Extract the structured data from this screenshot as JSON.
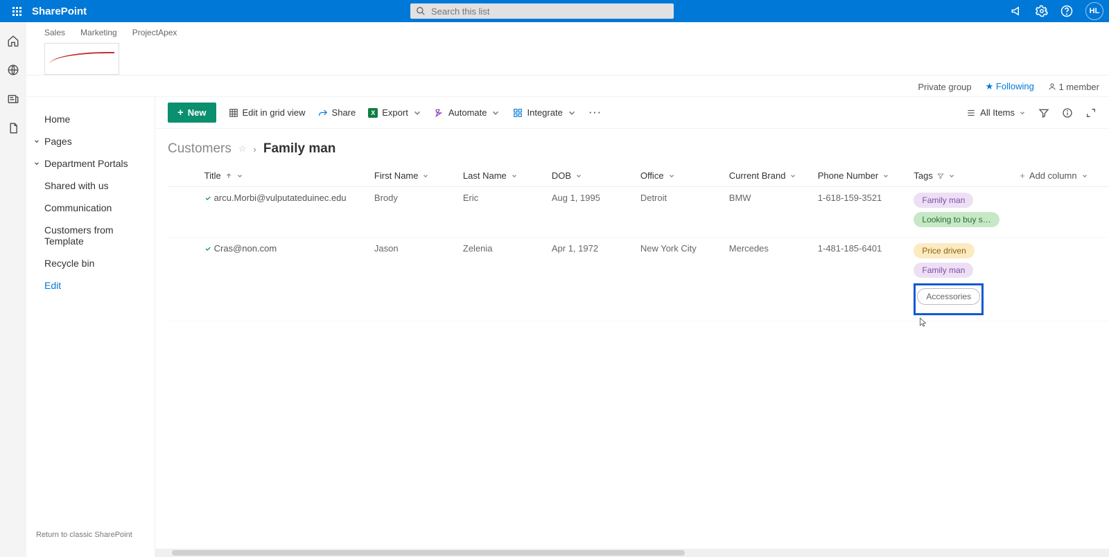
{
  "suite": {
    "brand": "SharePoint",
    "search_placeholder": "Search this list",
    "avatar": "HL"
  },
  "hub": {
    "links": [
      "Sales",
      "Marketing",
      "ProjectApex"
    ]
  },
  "siteinfo": {
    "group": "Private group",
    "following": "Following",
    "members": "1 member"
  },
  "nav": {
    "home": "Home",
    "pages": "Pages",
    "dept": "Department Portals",
    "shared": "Shared with us",
    "comm": "Communication",
    "cust": "Customers from Template",
    "recycle": "Recycle bin",
    "edit": "Edit",
    "classic": "Return to classic SharePoint"
  },
  "cmd": {
    "new": "New",
    "grid": "Edit in grid view",
    "share": "Share",
    "export": "Export",
    "automate": "Automate",
    "integrate": "Integrate",
    "view": "All Items"
  },
  "crumb": {
    "root": "Customers",
    "leaf": "Family man"
  },
  "columns": {
    "title": "Title",
    "first": "First Name",
    "last": "Last Name",
    "dob": "DOB",
    "office": "Office",
    "brand": "Current Brand",
    "phone": "Phone Number",
    "tags": "Tags",
    "add": "Add column"
  },
  "rows": [
    {
      "title": "arcu.Morbi@vulputateduinec.edu",
      "first": "Brody",
      "last": "Eric",
      "dob": "Aug 1, 1995",
      "office": "Detroit",
      "brand": "BMW",
      "phone": "1-618-159-3521",
      "tags": [
        {
          "text": "Family man",
          "cls": "family"
        },
        {
          "text": "Looking to buy s…",
          "cls": "looking"
        }
      ]
    },
    {
      "title": "Cras@non.com",
      "first": "Jason",
      "last": "Zelenia",
      "dob": "Apr 1, 1972",
      "office": "New York City",
      "brand": "Mercedes",
      "phone": "1-481-185-6401",
      "tags": [
        {
          "text": "Price driven",
          "cls": "price"
        },
        {
          "text": "Family man",
          "cls": "family"
        },
        {
          "text": "Accessories",
          "cls": "acc",
          "highlight": true
        }
      ]
    }
  ]
}
